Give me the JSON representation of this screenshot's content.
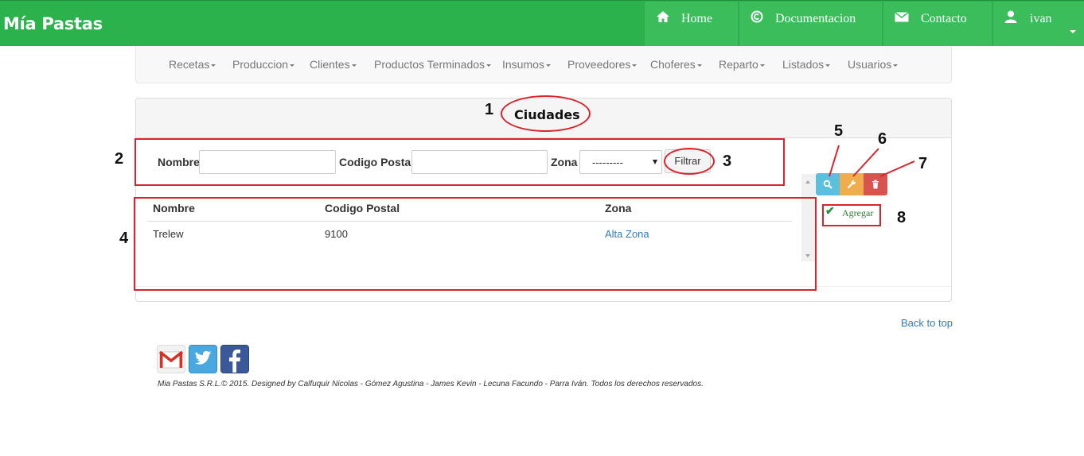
{
  "brand": "Mía Pastas",
  "topnav": {
    "home": "Home",
    "documentacion": "Documentacion",
    "contacto": "Contacto",
    "user": "ivan"
  },
  "menu": [
    "Recetas",
    "Produccion",
    "Clientes",
    "Productos Terminados",
    "Insumos",
    "Proveedores",
    "Choferes",
    "Reparto",
    "Listados",
    "Usuarios"
  ],
  "panel": {
    "title": "Ciudades"
  },
  "filter": {
    "nombre_label": "Nombre",
    "nombre_value": "",
    "cp_label": "Codigo Postal",
    "cp_value": "",
    "zona_label": "Zona",
    "zona_selected": "---------",
    "button": "Filtrar"
  },
  "table": {
    "headers": [
      "Nombre",
      "Codigo Postal",
      "Zona"
    ],
    "rows": [
      [
        "Trelew",
        "9100",
        "Alta Zona"
      ]
    ]
  },
  "actions": {
    "agregar": "Agregar"
  },
  "annotations": [
    "1",
    "2",
    "3",
    "4",
    "5",
    "6",
    "7",
    "8"
  ],
  "footer": {
    "back_to_top": "Back to top",
    "copyright": "Mia Pastas S.R.L.© 2015. Designed by Calfuquir Nicolas - Gómez Agustina - James Kevin - Lecuna Facundo - Parra Iván. Todos los derechos reservados."
  },
  "icons": [
    "home-icon",
    "copyright-icon",
    "envelope-icon",
    "user-icon",
    "search-icon",
    "wrench-icon",
    "trash-icon",
    "check-icon",
    "gmail-icon",
    "twitter-icon",
    "facebook-icon"
  ],
  "colors": {
    "navbar": "#2bb24c",
    "info": "#5bc0de",
    "warning": "#f0ad4e",
    "danger": "#d9534f",
    "annotation": "#d9232d",
    "link": "#337ab7"
  }
}
